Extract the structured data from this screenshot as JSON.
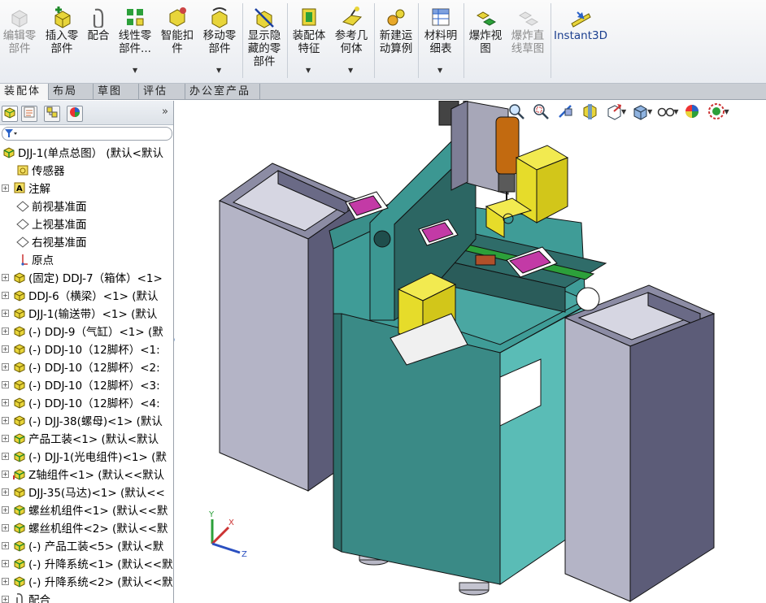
{
  "toolbar": {
    "items": [
      {
        "label": "编辑零\n部件",
        "icon": "edit-component-icon",
        "dim": true
      },
      {
        "label": "插入零\n部件",
        "icon": "insert-component-icon"
      },
      {
        "label": "配合",
        "icon": "mate-icon"
      },
      {
        "label": "线性零\n部件...",
        "icon": "linear-pattern-icon"
      },
      {
        "label": "智能扣\n件",
        "icon": "smart-fasteners-icon"
      },
      {
        "label": "移动零\n部件",
        "icon": "move-component-icon"
      },
      {
        "label": "显示隐\n藏的零\n部件",
        "icon": "show-hidden-components-icon"
      },
      {
        "label": "装配体\n特征",
        "icon": "assembly-features-icon"
      },
      {
        "label": "参考几\n何体",
        "icon": "reference-geometry-icon"
      },
      {
        "label": "新建运\n动算例",
        "icon": "new-motion-study-icon"
      },
      {
        "label": "材料明\n细表",
        "icon": "bill-of-materials-icon"
      },
      {
        "label": "爆炸视\n图",
        "icon": "exploded-view-icon"
      },
      {
        "label": "爆炸直\n线草图",
        "icon": "explode-line-sketch-icon",
        "dim": true
      },
      {
        "label": "Instant3D",
        "icon": "instant3d-icon"
      }
    ]
  },
  "tabs": [
    "装配体",
    "布局",
    "草图",
    "评估",
    "办公室产品"
  ],
  "tree": {
    "root": "DJJ-1(单点总图） (默认<默认",
    "items": [
      {
        "label": "传感器",
        "icon": "sensor-icon"
      },
      {
        "label": "注解",
        "icon": "annotations-icon",
        "expand": true
      },
      {
        "label": "前视基准面",
        "icon": "plane-icon"
      },
      {
        "label": "上视基准面",
        "icon": "plane-icon"
      },
      {
        "label": "右视基准面",
        "icon": "plane-icon"
      },
      {
        "label": "原点",
        "icon": "origin-icon"
      },
      {
        "label": "(固定) DDJ-7（箱体）<1>",
        "icon": "part-icon",
        "expand": true
      },
      {
        "label": "DDJ-6（横梁）<1> (默认",
        "icon": "part-icon",
        "expand": true
      },
      {
        "label": "DJJ-1(输送带）<1> (默认",
        "icon": "part-icon",
        "expand": true
      },
      {
        "label": "(-) DDJ-9（气缸）<1> (默",
        "icon": "part-icon",
        "expand": true
      },
      {
        "label": "(-) DDJ-10（12脚杯）<1:",
        "icon": "part-icon",
        "expand": true
      },
      {
        "label": "(-) DDJ-10（12脚杯）<2:",
        "icon": "part-icon",
        "expand": true
      },
      {
        "label": "(-) DDJ-10（12脚杯）<3:",
        "icon": "part-icon",
        "expand": true
      },
      {
        "label": "(-) DDJ-10（12脚杯）<4:",
        "icon": "part-icon",
        "expand": true
      },
      {
        "label": "(-) DJJ-38(螺母)<1> (默认",
        "icon": "part-icon",
        "expand": true
      },
      {
        "label": "产品工装<1> (默认<默认",
        "icon": "subassembly-icon",
        "expand": true
      },
      {
        "label": "(-) DJJ-1(光电组件)<1> (默",
        "icon": "subassembly-icon",
        "expand": true
      },
      {
        "label": "Z轴组件<1> (默认<<默认",
        "icon": "subassembly-warn-icon",
        "expand": true
      },
      {
        "label": "DJJ-35(马达)<1> (默认<<",
        "icon": "part-icon",
        "expand": true
      },
      {
        "label": "螺丝机组件<1> (默认<<默",
        "icon": "subassembly-icon",
        "expand": true
      },
      {
        "label": "螺丝机组件<2> (默认<<默",
        "icon": "subassembly-icon",
        "expand": true
      },
      {
        "label": "(-) 产品工装<5> (默认<默",
        "icon": "subassembly-icon",
        "expand": true
      },
      {
        "label": "(-) 升降系统<1> (默认<<默",
        "icon": "subassembly-icon",
        "expand": true
      },
      {
        "label": "(-) 升降系统<2> (默认<<默",
        "icon": "subassembly-icon",
        "expand": true
      },
      {
        "label": "配合",
        "icon": "mates-folder-icon",
        "expand": true
      }
    ]
  },
  "triad": {
    "x": "X",
    "y": "Y",
    "z": "Z"
  },
  "colors": {
    "teal": "#4aa7a2",
    "teal_dark": "#2d5f5d",
    "gray_front": "#b2b2c4",
    "gray_side": "#5e5e78",
    "yellow": "#e6dc2a",
    "magenta": "#c33aa6"
  }
}
